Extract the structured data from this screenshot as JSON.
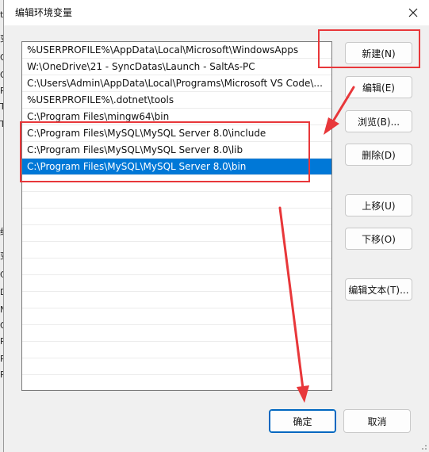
{
  "dialog": {
    "title": "编辑环境变量",
    "close_label": "×"
  },
  "path_list": {
    "items": [
      "%USERPROFILE%\\AppData\\Local\\Microsoft\\WindowsApps",
      "W:\\OneDrive\\21 - SyncDatas\\Launch - SaltAs-PC",
      "C:\\Users\\Admin\\AppData\\Local\\Programs\\Microsoft VS Code\\...",
      "%USERPROFILE%\\.dotnet\\tools",
      "C:\\Program Files\\mingw64\\bin",
      "C:\\Program Files\\MySQL\\MySQL Server 8.0\\include",
      "C:\\Program Files\\MySQL\\MySQL Server 8.0\\lib",
      "C:\\Program Files\\MySQL\\MySQL Server 8.0\\bin"
    ],
    "selected_index": 7
  },
  "buttons": {
    "new": "新建(N)",
    "edit": "编辑(E)",
    "browse": "浏览(B)...",
    "delete": "删除(D)",
    "move_up": "上移(U)",
    "move_down": "下移(O)",
    "edit_text": "编辑文本(T)...",
    "ok": "确定",
    "cancel": "取消"
  },
  "background_window": {
    "edge_chars": [
      "t",
      "变",
      "O",
      "O",
      "Pa",
      "TE",
      "TM",
      "统",
      "变",
      "Co",
      "Dr",
      "NI",
      "O",
      "Pa",
      "PA",
      "PF"
    ]
  },
  "colors": {
    "selection": "#0078d7",
    "annotation": "#e8373a",
    "ok_border": "#0067c0"
  }
}
